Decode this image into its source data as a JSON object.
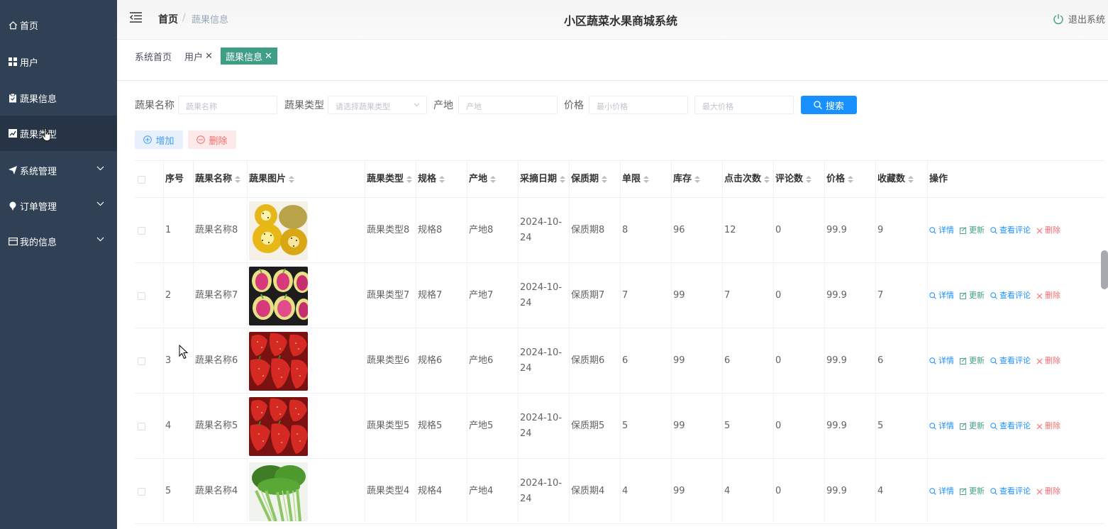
{
  "sidebar": {
    "items": [
      {
        "label": "首页",
        "icon": "home-icon"
      },
      {
        "label": "用户",
        "icon": "grid-icon"
      },
      {
        "label": "蔬果信息",
        "icon": "clipboard-icon"
      },
      {
        "label": "蔬果类型",
        "icon": "chart-icon"
      },
      {
        "label": "系统管理",
        "icon": "send-icon"
      },
      {
        "label": "订单管理",
        "icon": "pin-icon"
      },
      {
        "label": "我的信息",
        "icon": "card-icon"
      }
    ]
  },
  "header": {
    "breadcrumb_home": "首页",
    "breadcrumb_sep": "/",
    "breadcrumb_current": "蔬果信息",
    "title": "小区蔬菜水果商城系统",
    "logout": "退出系统"
  },
  "tags": [
    {
      "label": "系统首页"
    },
    {
      "label": "用户",
      "close": "✕"
    },
    {
      "label": "蔬果信息",
      "close": "✕"
    }
  ],
  "search": {
    "name_label": "蔬果名称",
    "name_placeholder": "蔬果名称",
    "type_label": "蔬果类型",
    "type_placeholder": "请选择蔬果类型",
    "origin_label": "产地",
    "origin_placeholder": "产地",
    "price_label": "价格",
    "min_price_placeholder": "最小价格",
    "max_price_placeholder": "最大价格",
    "button": "搜索"
  },
  "actions": {
    "add": "增加",
    "delete": "删除"
  },
  "table": {
    "headers": [
      "序号",
      "蔬果名称",
      "蔬果图片",
      "蔬果类型",
      "规格",
      "产地",
      "采摘日期",
      "保质期",
      "单限",
      "库存",
      "点击次数",
      "评论数",
      "价格",
      "收藏数",
      "操作"
    ],
    "ops": {
      "detail": "详情",
      "update": "更新",
      "comments": "查看评论",
      "delete": "删除"
    },
    "rows": [
      {
        "idx": "1",
        "name": "蔬果名称8",
        "img": "kiwi",
        "type": "蔬果类型8",
        "spec": "规格8",
        "origin": "产地8",
        "date": "2024-10-24",
        "shelf": "保质期8",
        "limit": "8",
        "stock": "96",
        "clicks": "12",
        "comments": "0",
        "price": "99.9",
        "favs": "9"
      },
      {
        "idx": "2",
        "name": "蔬果名称7",
        "img": "dragonfruit",
        "type": "蔬果类型7",
        "spec": "规格7",
        "origin": "产地7",
        "date": "2024-10-24",
        "shelf": "保质期7",
        "limit": "7",
        "stock": "99",
        "clicks": "7",
        "comments": "0",
        "price": "99.9",
        "favs": "7"
      },
      {
        "idx": "3",
        "name": "蔬果名称6",
        "img": "strawberry",
        "type": "蔬果类型6",
        "spec": "规格6",
        "origin": "产地6",
        "date": "2024-10-24",
        "shelf": "保质期6",
        "limit": "6",
        "stock": "99",
        "clicks": "6",
        "comments": "0",
        "price": "99.9",
        "favs": "6"
      },
      {
        "idx": "4",
        "name": "蔬果名称5",
        "img": "strawberry",
        "type": "蔬果类型5",
        "spec": "规格5",
        "origin": "产地5",
        "date": "2024-10-24",
        "shelf": "保质期5",
        "limit": "5",
        "stock": "99",
        "clicks": "5",
        "comments": "0",
        "price": "99.9",
        "favs": "5"
      },
      {
        "idx": "5",
        "name": "蔬果名称4",
        "img": "celery",
        "type": "蔬果类型4",
        "spec": "规格4",
        "origin": "产地4",
        "date": "2024-10-24",
        "shelf": "保质期4",
        "limit": "4",
        "stock": "99",
        "clicks": "4",
        "comments": "0",
        "price": "99.9",
        "favs": "4"
      }
    ]
  },
  "colors": {
    "sidebar_bg": "#304156",
    "primary": "#1890ff",
    "active_tag": "#3e9f86",
    "danger": "#f56c6c"
  }
}
